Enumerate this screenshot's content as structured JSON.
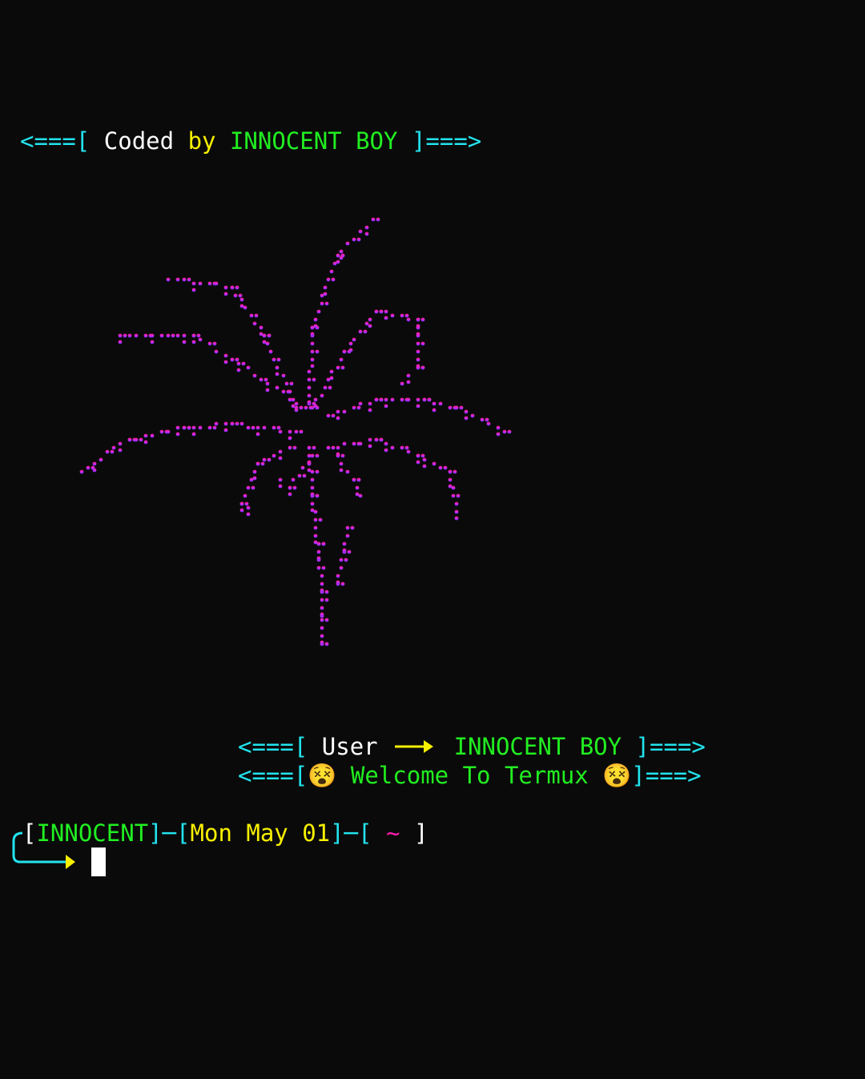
{
  "header": {
    "open": "<===[",
    "coded": "Coded",
    "by": "by",
    "name": "INNOCENT BOY",
    "close": "]===>"
  },
  "banner": {
    "user_line": {
      "open": "<===[",
      "label": "User",
      "name": "INNOCENT BOY",
      "close": "]===>"
    },
    "welcome_line": {
      "open": "<===[",
      "emoji": "😵",
      "text": "Welcome To Termux",
      "close": "]===>"
    }
  },
  "prompt": {
    "open1": "[",
    "user": "INNOCENT",
    "sep1": "]─[",
    "date": "Mon May 01",
    "sep2": "]─[",
    "path": "~",
    "close": "]"
  },
  "colors": {
    "background": "#0a0a0a",
    "cyan": "#22e3ee",
    "yellow": "#f8f000",
    "green": "#21ee21",
    "magenta": "#ff1ab0",
    "art_top": "#ff1a8c",
    "art_bottom": "#6a2cff"
  },
  "icons": {
    "arrow": "right-arrow-icon",
    "emoji": "dizzy-face-icon",
    "art": "braille-palm-tree-art"
  }
}
